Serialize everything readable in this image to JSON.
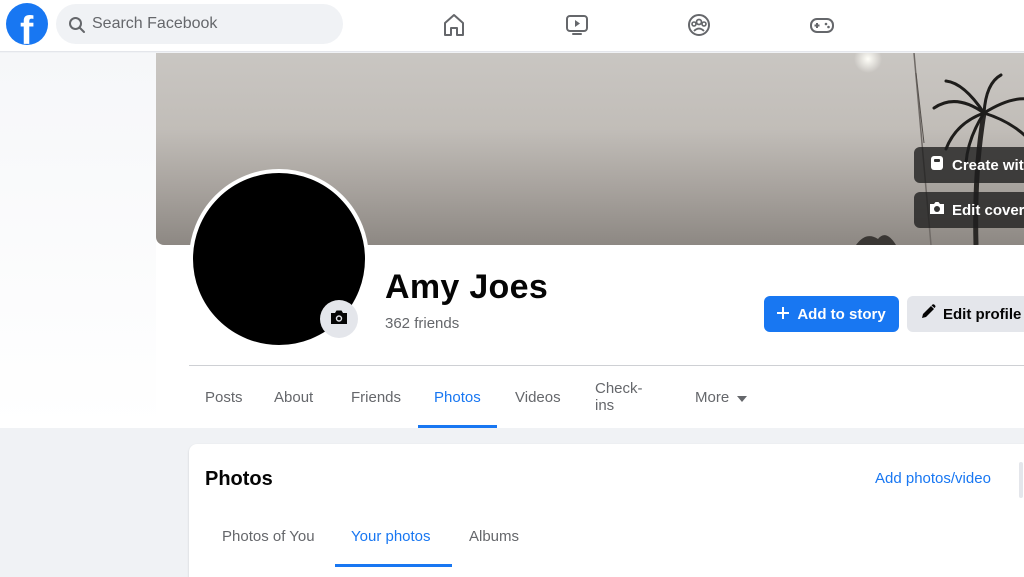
{
  "header": {
    "logo_letter": "f",
    "search_placeholder": "Search Facebook",
    "nav_icons": [
      "home-icon",
      "watch-icon",
      "groups-icon",
      "gaming-icon"
    ]
  },
  "cover": {
    "create_label": "Create with",
    "edit_cover_label": "Edit cover"
  },
  "profile": {
    "name": "Amy Joes",
    "friends": "362 friends",
    "add_story_label": "Add to story",
    "edit_profile_label": "Edit profile"
  },
  "tabs": [
    {
      "label": "Posts"
    },
    {
      "label": "About"
    },
    {
      "label": "Friends"
    },
    {
      "label": "Photos"
    },
    {
      "label": "Videos"
    },
    {
      "label": "Check-ins"
    },
    {
      "label": "More"
    }
  ],
  "active_tab": "Photos",
  "photos_card": {
    "title": "Photos",
    "add_link": "Add photos/video",
    "subtabs": [
      {
        "label": "Photos of You"
      },
      {
        "label": "Your photos"
      },
      {
        "label": "Albums"
      }
    ],
    "active_subtab": "Your photos"
  },
  "colors": {
    "brand": "#1877f2",
    "secondary_button": "#e4e6eb",
    "muted_text": "#65676b",
    "page_bg": "#f0f2f5"
  }
}
